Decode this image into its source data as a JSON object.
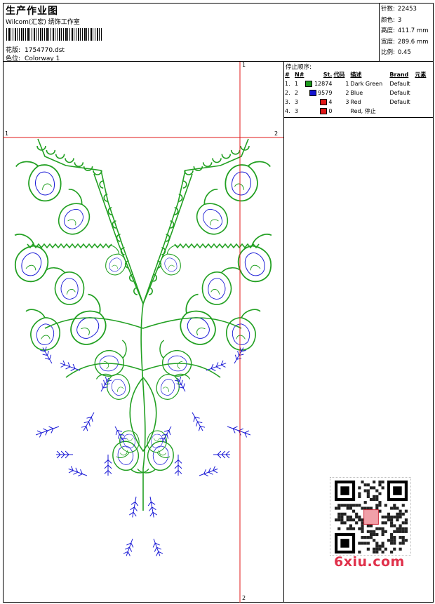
{
  "header": {
    "title": "生产作业图",
    "studio": "Wilcom(汇宏) 绣饰工作室",
    "file_label": "花版:",
    "file_name": "1754770.dst",
    "colorway_label": "色位:",
    "colorway_name": "Colorway 1"
  },
  "stats": [
    {
      "label": "针数:",
      "value": "22453"
    },
    {
      "label": "颜色:",
      "value": "3"
    },
    {
      "label": "高度:",
      "value": "411.7 mm"
    },
    {
      "label": "宽度:",
      "value": "289.6 mm"
    },
    {
      "label": "比例:",
      "value": "0.45"
    }
  ],
  "stop_sequence": {
    "title": "停止顺序:",
    "columns": [
      "#",
      "N#",
      "St.",
      "代码",
      "描述",
      "Brand",
      "元素"
    ],
    "rows": [
      {
        "idx": "1.",
        "n": "1",
        "color": "#1e9a1e",
        "stitches": "12874",
        "code": "1",
        "desc": "Dark Green",
        "brand": "Default"
      },
      {
        "idx": "2.",
        "n": "2",
        "color": "#1414d2",
        "stitches": "9579",
        "code": "2",
        "desc": "Blue",
        "brand": "Default"
      },
      {
        "idx": "3.",
        "n": "3",
        "color": "#e01818",
        "stitches": "4",
        "code": "3",
        "desc": "Red",
        "brand": "Default"
      },
      {
        "idx": "4.",
        "n": "3",
        "color": "#e01818",
        "stitches": "0",
        "code": "",
        "desc": "Red, 停止",
        "brand": ""
      }
    ]
  },
  "guides": {
    "top_marker": "1",
    "bottom_marker": "2",
    "left_marker": "1",
    "right_marker": "2"
  },
  "watermark": {
    "text": "6xiu.com",
    "qr_stamp": "秀闪图"
  },
  "colors": {
    "green": "#22a022",
    "blue": "#1a1ad6",
    "red": "#e01818"
  }
}
